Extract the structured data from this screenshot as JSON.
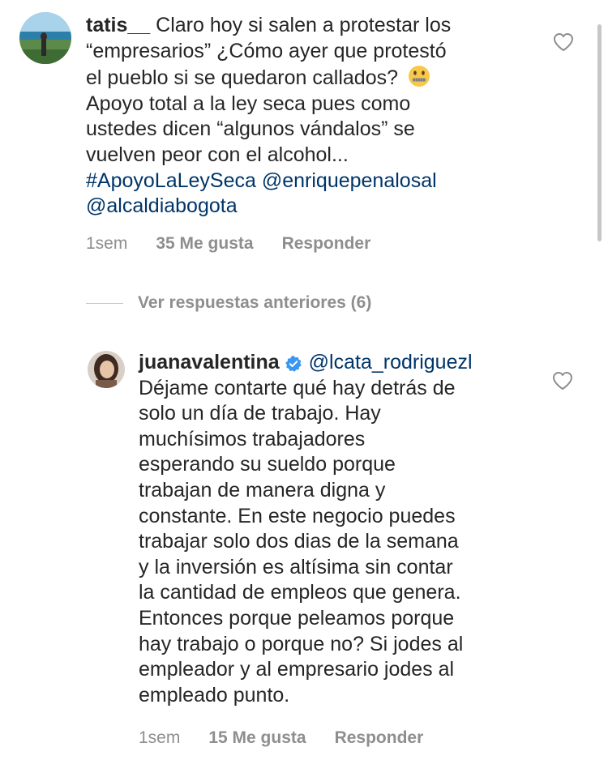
{
  "comments": [
    {
      "username": "tatis__",
      "text_lines": [
        "Claro hoy si salen a protestar los",
        "“empresarios” ¿Cómo ayer que protestó",
        "el pueblo si se quedaron callados?",
        "Apoyo total a la ley seca pues como",
        "ustedes dicen “algunos vándalos” se",
        "vuelven peor con el alcohol..."
      ],
      "emoji": "zipper-mouth-face",
      "hashtag": "#ApoyoLaLeySeca",
      "mention": "@enriquepenalosal",
      "mention2": "@alcaldiabogota",
      "time": "1sem",
      "likes": "35 Me gusta",
      "reply": "Responder"
    }
  ],
  "view_replies": "Ver respuestas anteriores (6)",
  "replies": [
    {
      "username": "juanavalentina",
      "verified": true,
      "mention": "@lcata_rodriguezl",
      "text_lines": [
        "Déjame contarte qué hay detrás de",
        "solo un día de trabajo. Hay",
        "muchísimos trabajadores",
        "esperando su sueldo porque",
        "trabajan de manera digna y",
        "constante. En este negocio puedes",
        "trabajar solo dos dias de la semana",
        "y la inversión es altísima sin contar",
        "la cantidad de empleos que genera.",
        "Entonces porque peleamos porque",
        "hay trabajo o porque no? Si jodes al",
        "empleador y al empresario jodes al",
        "empleado punto."
      ],
      "time": "1sem",
      "likes": "15 Me gusta",
      "reply": "Responder"
    }
  ],
  "icons": {
    "like": "heart-outline-icon",
    "verified": "verified-badge-icon"
  },
  "colors": {
    "text": "#262626",
    "link": "#003569",
    "meta": "#8e8e8e",
    "verified": "#3897f0"
  }
}
